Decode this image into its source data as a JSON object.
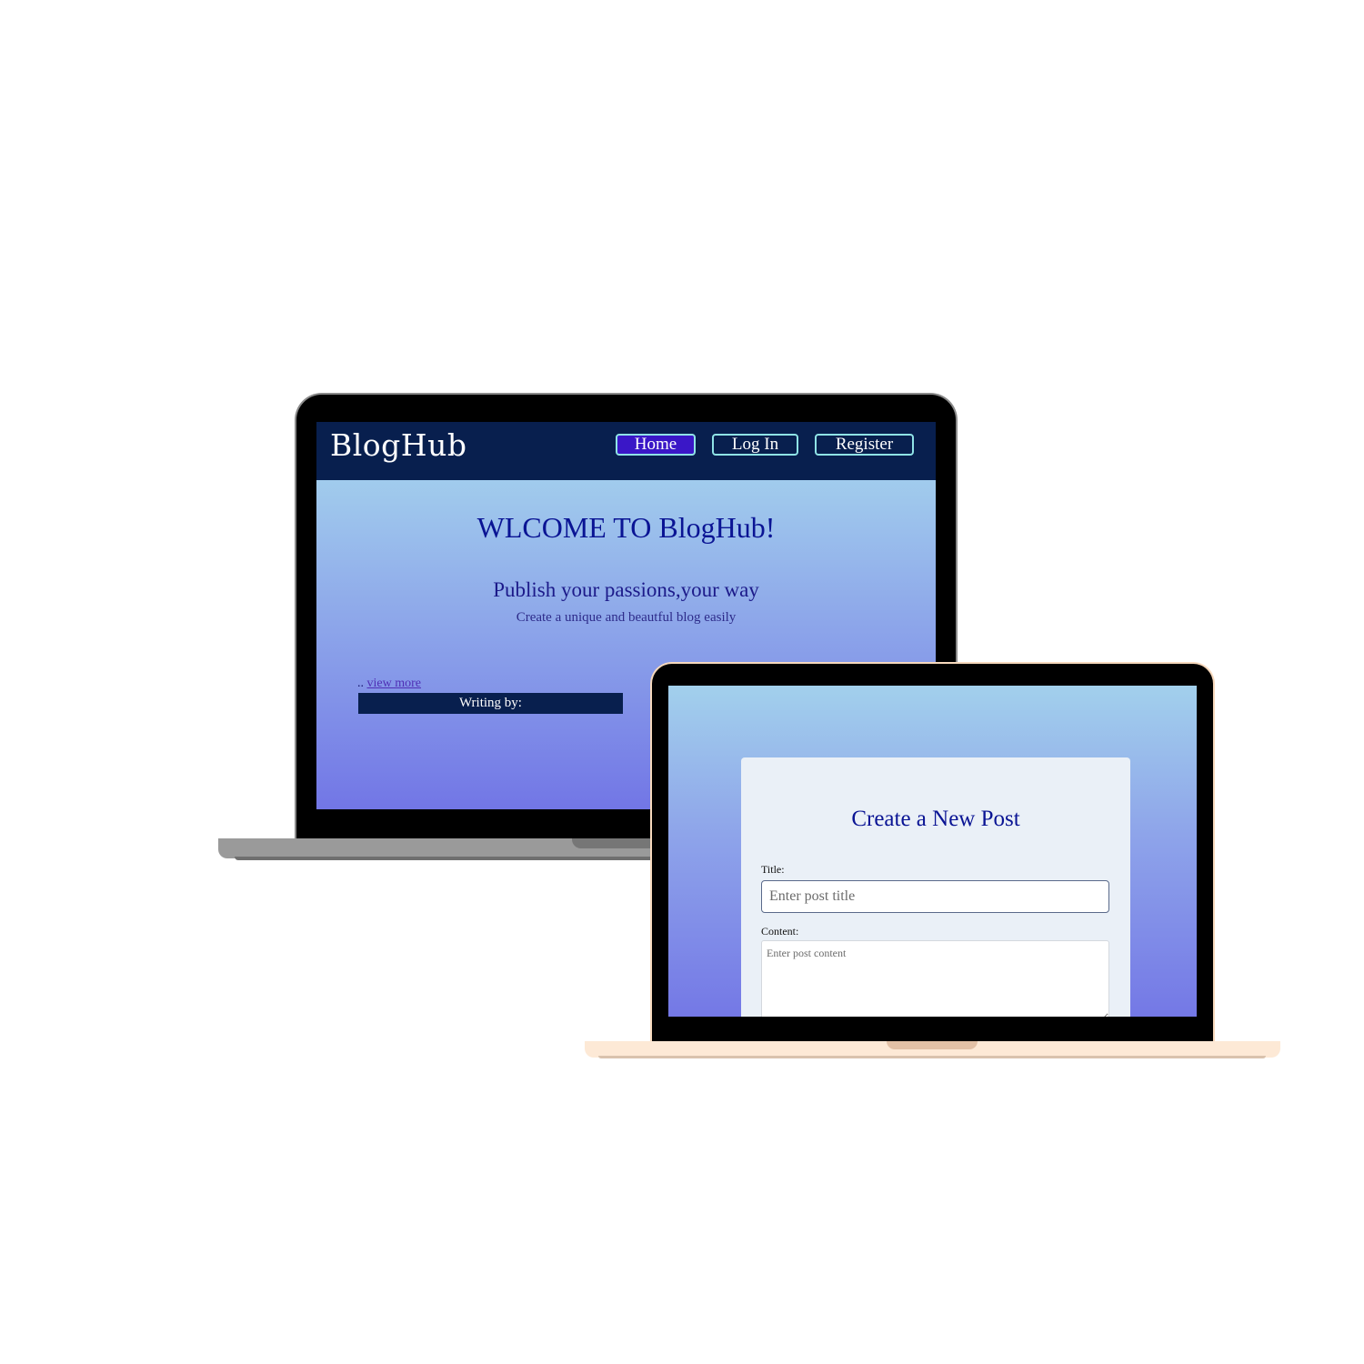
{
  "back_screen": {
    "brand": "BlogHub",
    "nav": {
      "home": "Home",
      "login": "Log In",
      "register": "Register"
    },
    "hero": {
      "title": "WLCOME TO BlogHub!",
      "subtitle": "Publish your passions,your way",
      "description": "Create a unique and beautful blog easily"
    },
    "post": {
      "prefix": "..",
      "view_more": "view more",
      "writing_by": "Writing by:"
    }
  },
  "front_screen": {
    "form": {
      "heading": "Create a New Post",
      "title_label": "Title:",
      "title_placeholder": "Enter post title",
      "content_label": "Content:",
      "content_placeholder": "Enter post content"
    }
  },
  "colors": {
    "navbar": "#081f4e",
    "active_button": "#3a17c7",
    "button_border": "#8fe3e6",
    "heading": "#0a1494",
    "form_card": "#eaf0f7",
    "back_laptop_base": "#9a9a9a",
    "front_laptop_base": "#fde9d6"
  }
}
